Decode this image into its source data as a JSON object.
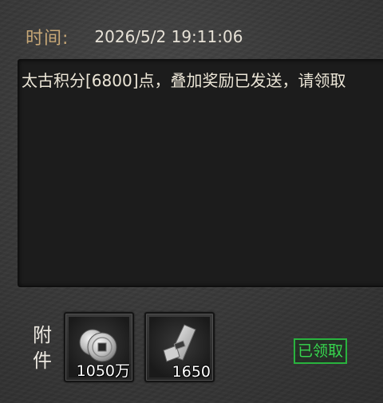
{
  "mail": {
    "time_label": "时间:",
    "time_value": "2026/5/2 19:11:06",
    "message": "太古积分[6800]点，叠加奖励已发送，请领取"
  },
  "attachments": {
    "label_chars": [
      "附",
      "件"
    ],
    "items": [
      {
        "icon": "coin-stack-icon",
        "count": "1050万"
      },
      {
        "icon": "silver-scroll-icon",
        "count": "1650"
      }
    ]
  },
  "status": {
    "claimed_label": "已领取",
    "claimed_color": "#37d64e"
  }
}
